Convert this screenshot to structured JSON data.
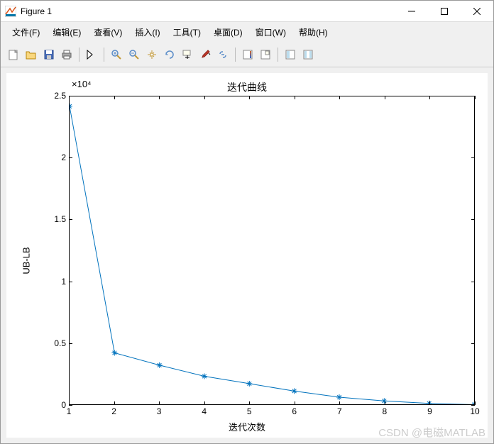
{
  "window": {
    "title": "Figure 1"
  },
  "menu": {
    "file": "文件(F)",
    "edit": "编辑(E)",
    "view": "查看(V)",
    "insert": "插入(I)",
    "tools": "工具(T)",
    "desktop": "桌面(D)",
    "window_menu": "窗口(W)",
    "help": "帮助(H)"
  },
  "chart_data": {
    "type": "line",
    "title": "迭代曲线",
    "xlabel": "迭代次数",
    "ylabel": "UB-LB",
    "y_multiplier": "×10⁴",
    "x": [
      1,
      2,
      3,
      4,
      5,
      6,
      7,
      8,
      9,
      10
    ],
    "y": [
      24200,
      4200,
      3200,
      2300,
      1700,
      1100,
      600,
      300,
      100,
      0
    ],
    "xticks": [
      1,
      2,
      3,
      4,
      5,
      6,
      7,
      8,
      9,
      10
    ],
    "yticks": [
      0,
      0.5,
      1,
      1.5,
      2,
      2.5
    ],
    "xlim": [
      1,
      10
    ],
    "ylim": [
      0,
      25000
    ],
    "marker": "*",
    "line_color": "#0072bd"
  },
  "watermark": "CSDN @电磁MATLAB"
}
